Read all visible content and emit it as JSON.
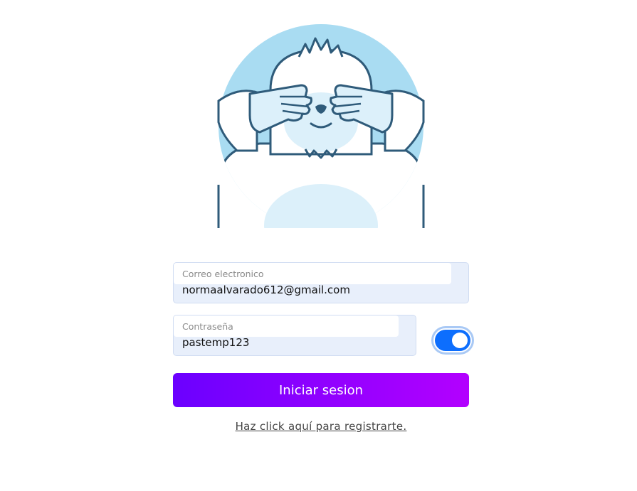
{
  "form": {
    "email": {
      "label": "Correo electronico",
      "value": "normaalvarado612@gmail.com"
    },
    "password": {
      "label": "Contraseña",
      "value": "pastemp123"
    },
    "show_password_toggle": {
      "checked": true
    },
    "submit_label": "Iniciar sesion",
    "register_link": "Haz click aquí para registrarte."
  },
  "colors": {
    "accent_start": "#6b00ff",
    "accent_end": "#b300ff",
    "toggle_on": "#0d6efd",
    "mascot_bg": "#a9dcf2",
    "mascot_outline": "#2f5b7a"
  },
  "icons": {
    "mascot": "yeti-covering-eyes-illustration"
  }
}
